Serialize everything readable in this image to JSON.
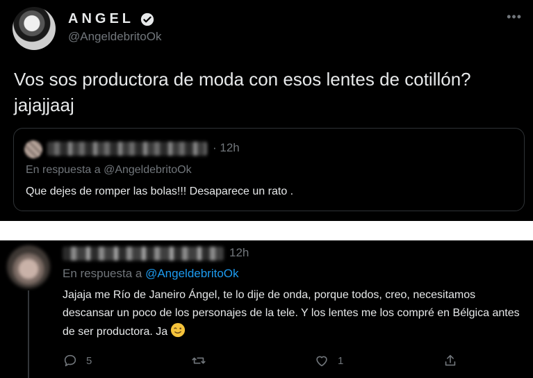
{
  "main_tweet": {
    "author_name": "ANGEL",
    "handle": "@AngeldebritoOk",
    "text": "Vos sos productora de moda con esos lentes de cotillón?jajajjaaj",
    "more_icon": "more-icon"
  },
  "quoted_tweet": {
    "time": "· 12h",
    "reply_prefix": "En respuesta a @AngeldebritoOk",
    "text": "Que dejes de romper las bolas!!! Desaparece un rato ."
  },
  "reply_tweet": {
    "time": "12h",
    "reply_prefix": "En respuesta a ",
    "reply_mention": "@AngeldebritoOk",
    "text": "Jajaja me Río de Janeiro Ángel, te lo dije de onda, porque todos, creo, necesitamos descansar un poco de los personajes de la tele. Y los lentes me los compré en Bélgica antes de ser productora. Ja",
    "emoji": "wink-emoji",
    "actions": {
      "reply_count": "5",
      "retweet_count": "",
      "like_count": "1"
    }
  },
  "colors": {
    "background": "#000000",
    "text": "#e7e9ea",
    "muted": "#71767b",
    "accent": "#1d9bf0",
    "separator": "#ffffff"
  }
}
